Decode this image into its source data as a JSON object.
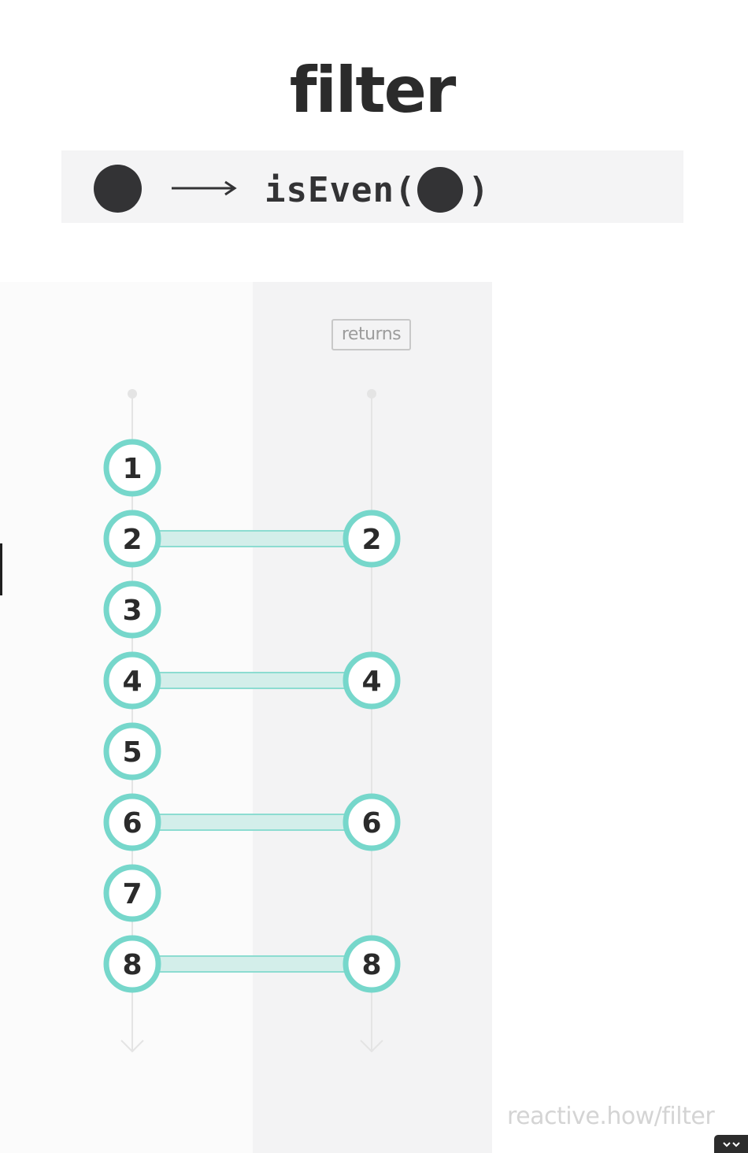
{
  "title": "filter",
  "signature": {
    "arrow": "⟶",
    "code_prefix": "isEven(",
    "code_suffix": ")"
  },
  "returns_label": "returns",
  "credit": "reactive.how/filter",
  "colors": {
    "marble_stroke": "#76d7cb",
    "connector_fill": "#d3eeea",
    "connector_stroke": "#8cdcd1",
    "timeline": "#e4e4e4",
    "text_dark": "#2b2b2b"
  },
  "icons": {
    "input_marble": "filled-circle",
    "expand": "expand-arrows-icon"
  },
  "diagram_data": {
    "operator": "filter",
    "predicate": "isEven",
    "input_values": [
      "1",
      "2",
      "3",
      "4",
      "5",
      "6",
      "7",
      "8"
    ],
    "output_values": [
      "2",
      "4",
      "6",
      "8"
    ]
  }
}
